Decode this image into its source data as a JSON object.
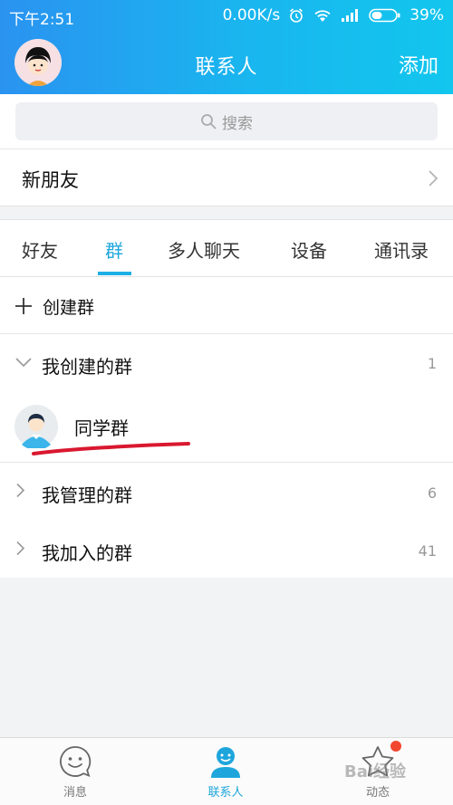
{
  "status": {
    "time": "下午2:51",
    "speed": "0.00K/s",
    "battery": "39%"
  },
  "header": {
    "title": "联系人",
    "add_label": "添加"
  },
  "search": {
    "placeholder": "搜索"
  },
  "new_friends": {
    "label": "新朋友"
  },
  "tabs": [
    {
      "label": "好友"
    },
    {
      "label": "群",
      "active": true
    },
    {
      "label": "多人聊天"
    },
    {
      "label": "设备"
    },
    {
      "label": "通讯录"
    }
  ],
  "create_group": {
    "label": "创建群"
  },
  "sections": {
    "created": {
      "label": "我创建的群",
      "count": "1",
      "expanded": true
    },
    "managed": {
      "label": "我管理的群",
      "count": "6"
    },
    "joined": {
      "label": "我加入的群",
      "count": "41"
    }
  },
  "groups": [
    {
      "name": "同学群"
    }
  ],
  "bottom_nav": [
    {
      "label": "消息"
    },
    {
      "label": "联系人",
      "active": true
    },
    {
      "label": "动态"
    }
  ],
  "watermark": "Bai经验",
  "colors": {
    "accent": "#1ea6dc",
    "header_start": "#2a93f0",
    "header_end": "#12c6ee",
    "badge": "#f2472f",
    "annotation": "#d9182f"
  }
}
